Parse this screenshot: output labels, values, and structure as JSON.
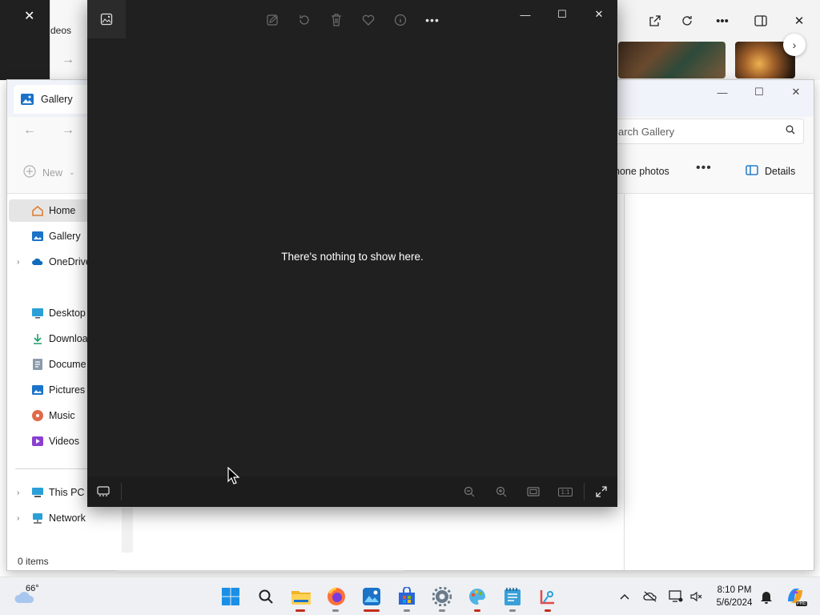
{
  "browser_bg": {
    "controls": [
      "open-external-icon",
      "refresh-icon",
      "more-icon",
      "sidebar-toggle-icon",
      "close-icon"
    ]
  },
  "mid_window": {
    "label_partial": "deos"
  },
  "explorer": {
    "tab_title": "Gallery",
    "window_controls": {
      "minimize": "—",
      "maximize": "☐",
      "close": "✕"
    },
    "search_placeholder": "arch Gallery",
    "toolbar": {
      "new_label": "New",
      "phone_label": "hone photos",
      "more_label": "•••",
      "details_label": "Details"
    },
    "sidebar": {
      "items": [
        {
          "label": "Home",
          "icon": "home-icon",
          "selected": true,
          "expandable": false
        },
        {
          "label": "Gallery",
          "icon": "gallery-icon",
          "expandable": false
        },
        {
          "label": "OneDrive",
          "icon": "onedrive-icon",
          "expandable": true
        },
        {
          "label": "Desktop",
          "icon": "desktop-icon",
          "expandable": false
        },
        {
          "label": "Downloa",
          "icon": "downloads-icon",
          "expandable": false
        },
        {
          "label": "Docume",
          "icon": "documents-icon",
          "expandable": false
        },
        {
          "label": "Pictures",
          "icon": "pictures-icon",
          "expandable": false
        },
        {
          "label": "Music",
          "icon": "music-icon",
          "expandable": false
        },
        {
          "label": "Videos",
          "icon": "videos-icon",
          "expandable": false
        },
        {
          "label": "This PC",
          "icon": "this-pc-icon",
          "expandable": true
        },
        {
          "label": "Network",
          "icon": "network-icon",
          "expandable": true
        }
      ]
    },
    "status": "0 items"
  },
  "viewer": {
    "empty_message": "There's nothing to show here.",
    "top_tools": [
      "edit-icon",
      "rotate-icon",
      "delete-icon",
      "favorite-icon",
      "info-icon",
      "more-icon"
    ],
    "window_controls": {
      "minimize": "—",
      "maximize": "☐",
      "close": "✕"
    },
    "bottom_tools": [
      "zoom-out-icon",
      "zoom-in-icon",
      "fit-icon",
      "actual-size-icon",
      "fullscreen-icon"
    ],
    "actual_size_label": "1:1"
  },
  "taskbar": {
    "weather_temp": "66°",
    "apps": [
      "start-icon",
      "search-icon",
      "file-explorer-icon",
      "firefox-icon",
      "photos-icon",
      "store-icon",
      "settings-icon",
      "paint-icon",
      "notepad-icon",
      "snipping-tool-icon"
    ],
    "clock_time": "8:10 PM",
    "clock_date": "5/6/2024",
    "copilot_badge": "PRE"
  },
  "colors": {
    "viewer_bg": "#202020",
    "accent": "#0067c0",
    "taskbar_bg": "#eef0f3"
  }
}
